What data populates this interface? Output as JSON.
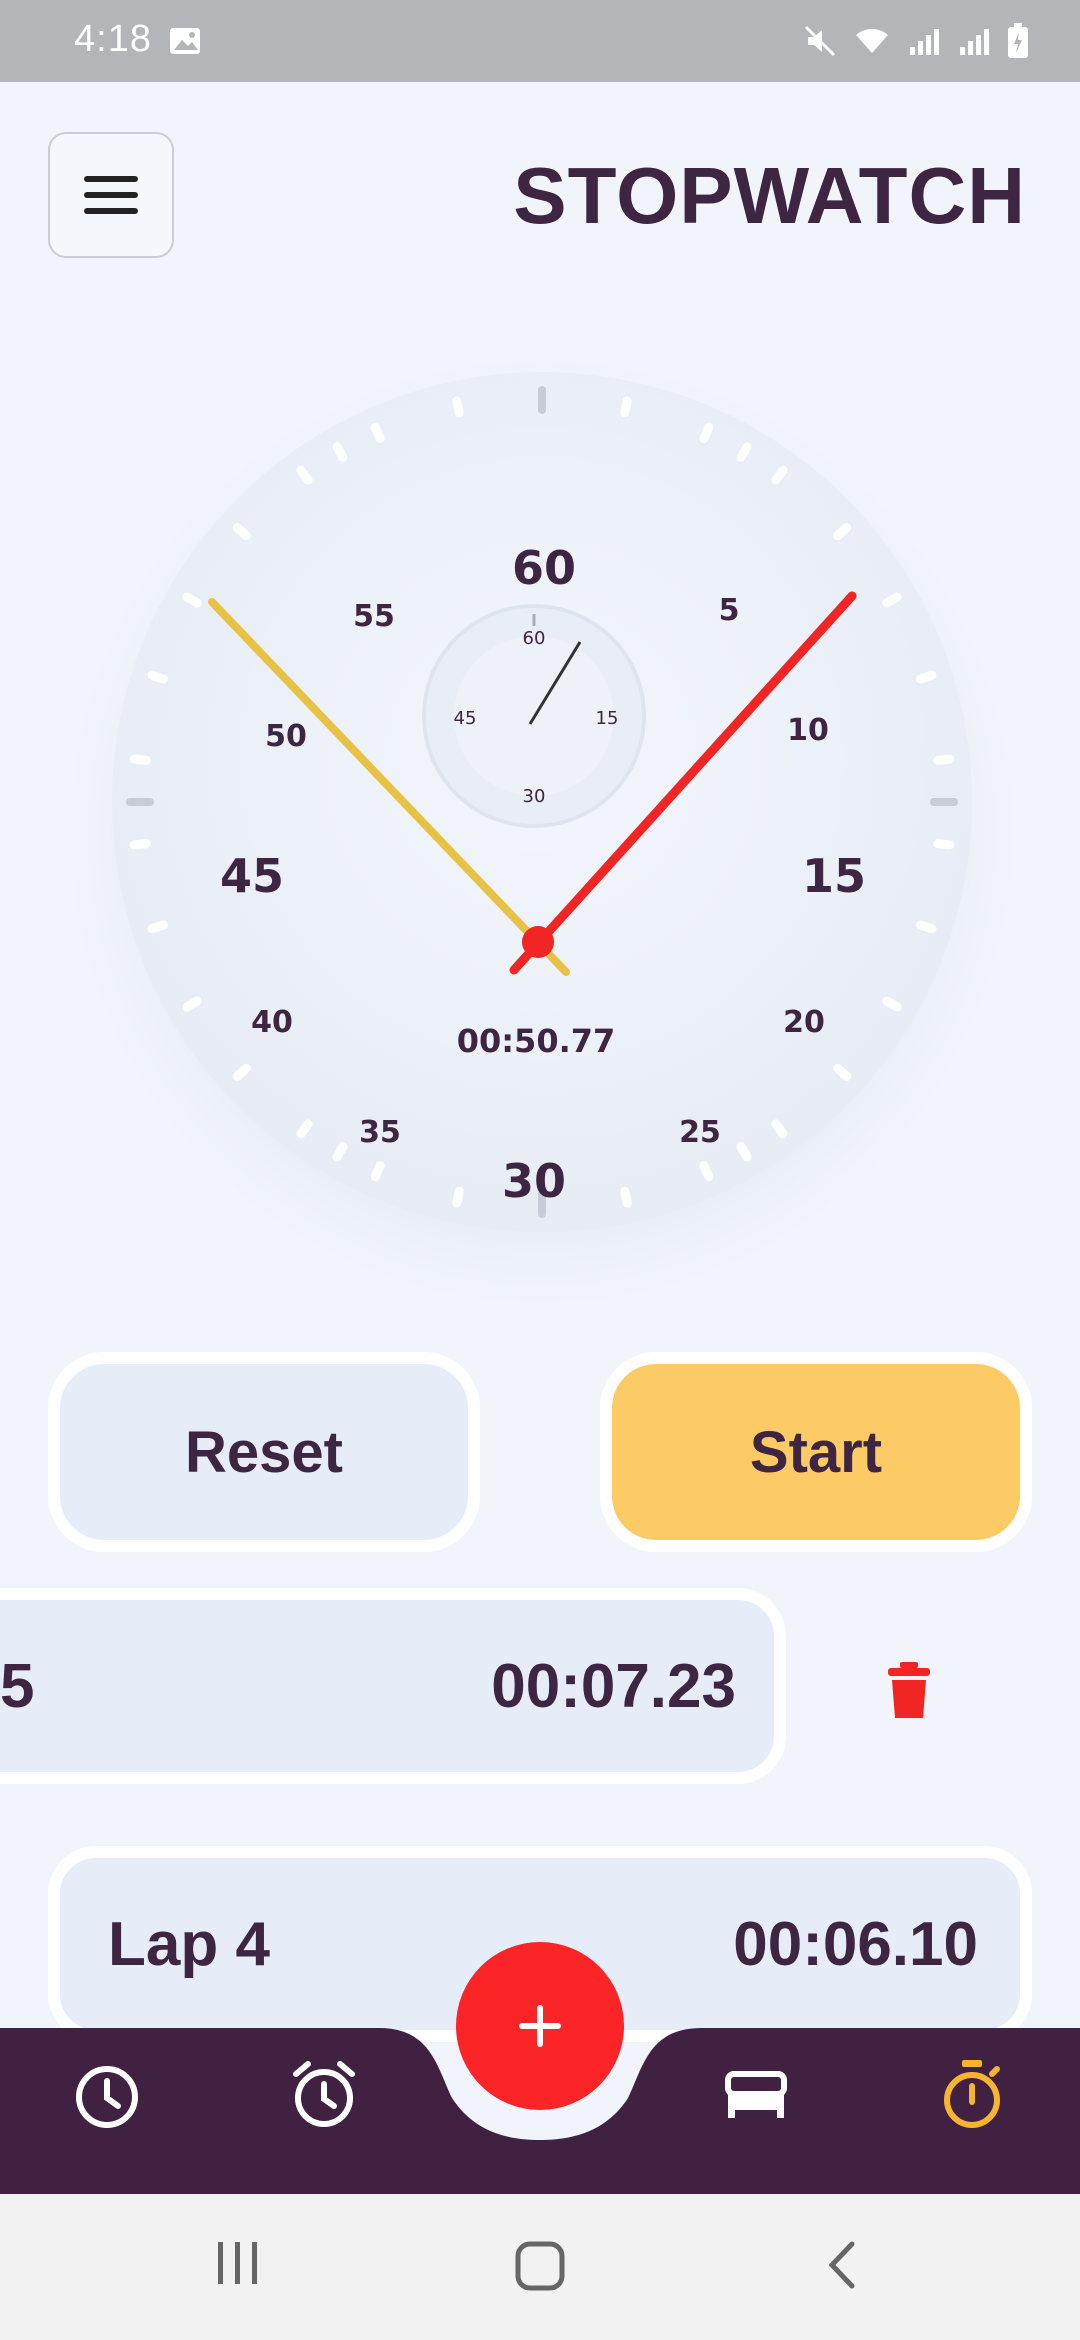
{
  "status_bar": {
    "time": "4:18"
  },
  "header": {
    "title": "STOPWATCH"
  },
  "dial": {
    "elapsed": "00:50.77",
    "major_labels": [
      "60",
      "15",
      "30",
      "45"
    ],
    "minor_labels": [
      "5",
      "10",
      "20",
      "25",
      "35",
      "40",
      "50",
      "55"
    ],
    "sub_dial_labels": [
      "60",
      "15",
      "30",
      "45"
    ],
    "colors": {
      "lap_hand": "#e8c245",
      "second_hand": "#f22525"
    }
  },
  "controls": {
    "reset_label": "Reset",
    "start_label": "Start"
  },
  "laps": [
    {
      "label": "5",
      "time": "00:07.23"
    },
    {
      "label": "Lap 4",
      "time": "00:06.10"
    }
  ],
  "bottom_nav": {
    "items": [
      "clock-icon",
      "alarm-icon",
      "add-icon",
      "bed-icon",
      "stopwatch-icon"
    ],
    "active_color": "#f6b52d",
    "bar_color": "#402142",
    "fab_color": "#fb2427"
  }
}
